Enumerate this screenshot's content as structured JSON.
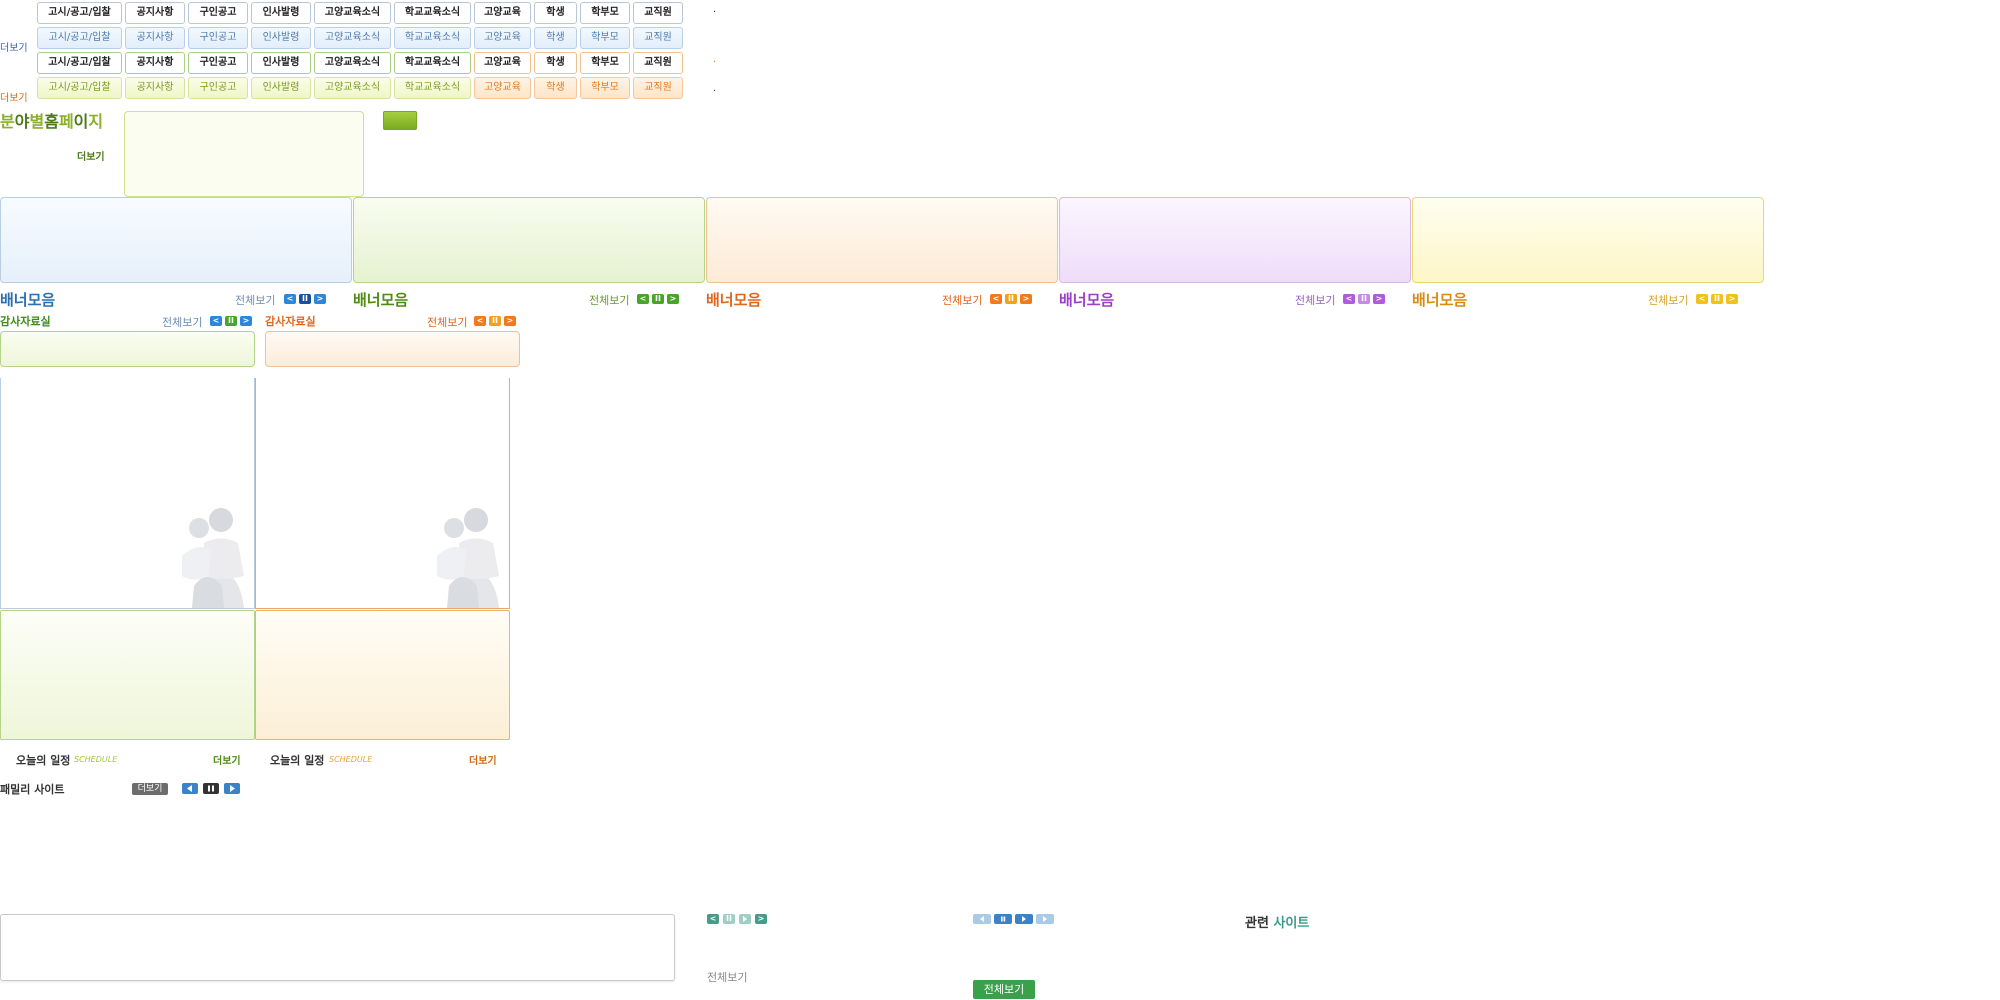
{
  "tabs": {
    "labels": [
      "고시/공고/입찰",
      "공지사항",
      "구인공고",
      "인사발령",
      "고양교육소식",
      "학교교육소식",
      "고양교육",
      "학생",
      "학부모",
      "교직원"
    ],
    "more": "더보기",
    "bullet": "·"
  },
  "field_homepage": {
    "title_chars": [
      "분",
      "야",
      "별",
      "홈",
      "페",
      "이",
      "지"
    ],
    "more": "더보기"
  },
  "banners": [
    {
      "title": "배너모음",
      "view_all": "전체보기",
      "color": "#2a6fb0",
      "ctrl_color": "#2d86d8"
    },
    {
      "title": "배너모음",
      "view_all": "전체보기",
      "color": "#4f8a14",
      "ctrl_color": "#48a52a"
    },
    {
      "title": "배너모음",
      "view_all": "전체보기",
      "color": "#e0661d",
      "ctrl_color": "#f27a1a"
    },
    {
      "title": "배너모음",
      "view_all": "전체보기",
      "color": "#9a3fc9",
      "ctrl_color": "#b05ae0"
    },
    {
      "title": "배너모음",
      "view_all": "전체보기",
      "color": "#d98c12",
      "ctrl_color": "#f2b51a"
    }
  ],
  "audit": [
    {
      "title": "감사자료실",
      "view_all": "전체보기",
      "color": "#3d8b1a"
    },
    {
      "title": "감사자료실",
      "view_all": "전체보기",
      "color": "#e0661d"
    }
  ],
  "schedule": [
    {
      "title": "오늘의 일정",
      "sub": "SCHEDULE",
      "more": "더보기",
      "sub_color": "#a6c43a",
      "more_color": "#4f8a14"
    },
    {
      "title": "오늘의 일정",
      "sub": "SCHEDULE",
      "more": "더보기",
      "sub_color": "#e8a33a",
      "more_color": "#d46a10"
    }
  ],
  "family": {
    "title": "패밀리 사이트",
    "more": "더보기"
  },
  "related": {
    "title_dark": "관련",
    "title_color": "사이트"
  },
  "bottom": {
    "view_all_text": "전체보기",
    "view_all_button": "전체보기"
  },
  "controls": {
    "prev": "<",
    "pause": "II",
    "next": ">"
  }
}
